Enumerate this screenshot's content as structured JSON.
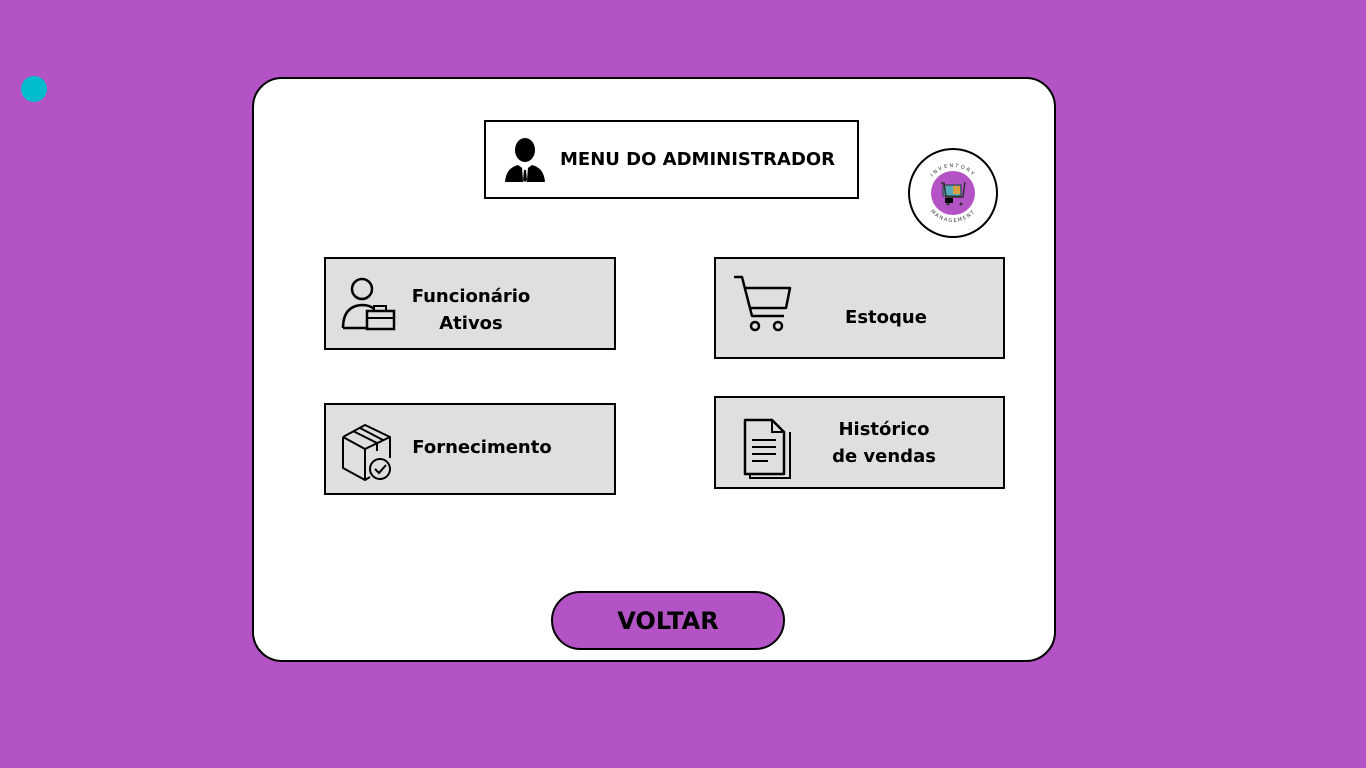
{
  "header": {
    "title": "MENU DO ADMINISTRADOR",
    "icon": "admin-user-icon"
  },
  "logo": {
    "top_text": "INVENTORY",
    "bottom_text": "MANAGEMENT"
  },
  "menu": {
    "funcionario": {
      "line1": "Funcionário",
      "line2": "Ativos",
      "icon": "employee-briefcase-icon"
    },
    "estoque": {
      "label": "Estoque",
      "icon": "shopping-cart-icon"
    },
    "fornecimento": {
      "label": "Fornecimento",
      "icon": "box-check-icon"
    },
    "historico": {
      "line1": "Histórico",
      "line2": "de vendas",
      "icon": "document-icon"
    }
  },
  "voltar_label": "VOLTAR",
  "colors": {
    "background": "#b353c5",
    "card": "#dfdfdf",
    "dot": "#00bccd"
  }
}
